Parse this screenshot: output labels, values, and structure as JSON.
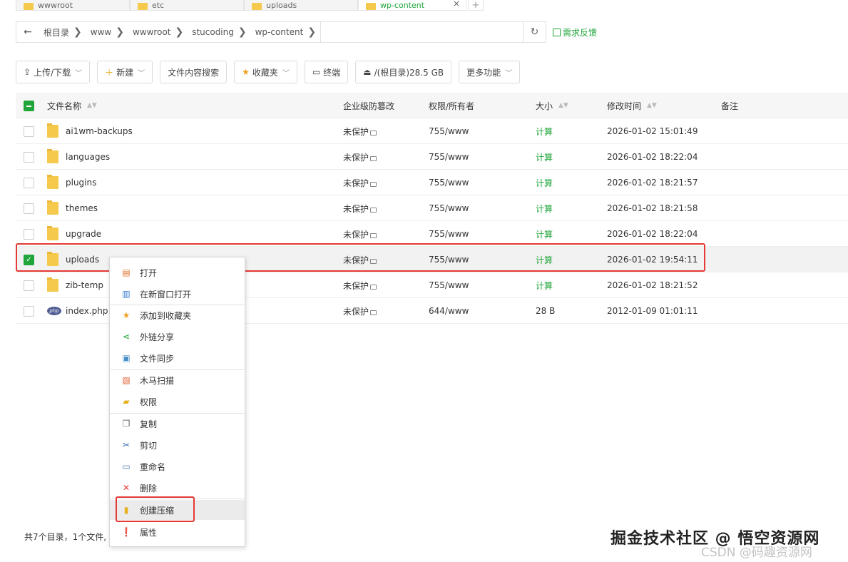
{
  "tabs": [
    {
      "label": "wwwroot"
    },
    {
      "label": "etc"
    },
    {
      "label": "uploads"
    },
    {
      "label": "wp-content",
      "close": "×"
    }
  ],
  "tab_add": "+",
  "path": {
    "back": "←",
    "crumbs": [
      "根目录",
      "www",
      "wwwroot",
      "stucoding",
      "wp-content"
    ],
    "sep": "❯",
    "refresh": "↻"
  },
  "feedback": "需求反馈",
  "toolbar": [
    {
      "icon": "⇪",
      "label": "上传/下载",
      "dropdown": "﹀"
    },
    {
      "icon": "＋",
      "label": "新建",
      "dropdown": "﹀"
    },
    {
      "icon": "",
      "label": "文件内容搜索",
      "dropdown": ""
    },
    {
      "icon": "★",
      "label": "收藏夹",
      "dropdown": "﹀"
    },
    {
      "icon": "▭",
      "label": "终端",
      "dropdown": ""
    },
    {
      "icon": "⏏",
      "label": "/(根目录)28.5 GB",
      "dropdown": ""
    },
    {
      "icon": "",
      "label": "更多功能",
      "dropdown": "﹀"
    }
  ],
  "table": {
    "headers": {
      "name": "文件名称",
      "protect": "企业级防篡改",
      "perm": "权限/所有者",
      "size": "大小",
      "mtime": "修改时间",
      "note": "备注"
    },
    "sort_icon": "▲▼",
    "rows": [
      {
        "name": "ai1wm-backups",
        "protect": "未保护",
        "perm": "755/www",
        "size": "计算",
        "mtime": "2026-01-02 15:01:49"
      },
      {
        "name": "languages",
        "protect": "未保护",
        "perm": "755/www",
        "size": "计算",
        "mtime": "2026-01-02 18:22:04"
      },
      {
        "name": "plugins",
        "protect": "未保护",
        "perm": "755/www",
        "size": "计算",
        "mtime": "2026-01-02 18:21:57"
      },
      {
        "name": "themes",
        "protect": "未保护",
        "perm": "755/www",
        "size": "计算",
        "mtime": "2026-01-02 18:21:58"
      },
      {
        "name": "upgrade",
        "protect": "未保护",
        "perm": "755/www",
        "size": "计算",
        "mtime": "2026-01-02 18:22:04"
      },
      {
        "name": "uploads",
        "protect": "未保护",
        "perm": "755/www",
        "size": "计算",
        "mtime": "2026-01-02 19:54:11",
        "checked": true
      },
      {
        "name": "zib-temp",
        "protect": "未保护",
        "perm": "755/www",
        "size": "计算",
        "mtime": "2026-01-02 18:21:52"
      },
      {
        "name": "index.php",
        "protect": "未保护",
        "perm": "644/www",
        "size": "28 B",
        "mtime": "2012-01-09 01:01:11",
        "php": true
      }
    ]
  },
  "php_badge": "php",
  "footer": "共7个目录，1个文件,",
  "context_menu": {
    "items": [
      {
        "label": "打开",
        "icon": "open-icon",
        "glyph": "▤",
        "color": "#e0702b"
      },
      {
        "label": "在新窗口打开",
        "icon": "new-window-icon",
        "glyph": "▥",
        "color": "#3a7bd5"
      },
      {
        "label": "添加到收藏夹",
        "icon": "star-icon",
        "glyph": "★",
        "color": "#f0a020"
      },
      {
        "label": "外链分享",
        "icon": "share-icon",
        "glyph": "⋖",
        "color": "#20a53a"
      },
      {
        "label": "文件同步",
        "icon": "sync-icon",
        "glyph": "▣",
        "color": "#4a90c8"
      },
      {
        "label": "木马扫描",
        "icon": "scan-icon",
        "glyph": "▧",
        "color": "#e06030"
      },
      {
        "label": "权限",
        "icon": "permission-icon",
        "glyph": "▰",
        "color": "#e8b020"
      },
      {
        "label": "复制",
        "icon": "copy-icon",
        "glyph": "❐",
        "color": "#666666"
      },
      {
        "label": "剪切",
        "icon": "scissors-icon",
        "glyph": "✂",
        "color": "#3a6fb0"
      },
      {
        "label": "重命名",
        "icon": "rename-icon",
        "glyph": "▭",
        "color": "#4a7ab0"
      },
      {
        "label": "删除",
        "icon": "delete-icon",
        "glyph": "✕",
        "color": "#e53935"
      },
      {
        "label": "创建压缩",
        "icon": "archive-icon",
        "glyph": "▮",
        "color": "#e8b020",
        "active": true
      },
      {
        "label": "属性",
        "icon": "info-icon",
        "glyph": "❗",
        "color": "#777777"
      }
    ]
  },
  "watermark": {
    "main": "掘金技术社区 @ 悟空资源网",
    "sub": "CSDN @码趣资源网"
  },
  "colors": {
    "accent": "#20a53a",
    "highlight": "#e53935"
  }
}
